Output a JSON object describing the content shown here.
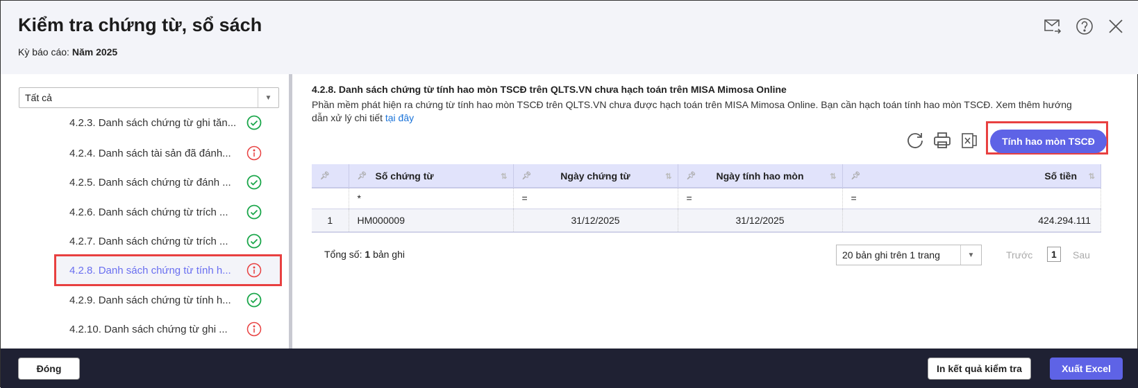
{
  "header": {
    "title": "Kiểm tra chứng từ, sổ sách",
    "period_label": "Kỳ báo cáo:",
    "period_value": "Năm 2025"
  },
  "sidebar": {
    "filter": "Tất cả",
    "items": [
      {
        "label": "4.2.3. Danh sách chứng từ ghi tăn...",
        "status": "ok"
      },
      {
        "label": "4.2.4. Danh sách tài sản đã đánh...",
        "status": "warning"
      },
      {
        "label": "4.2.5. Danh sách chứng từ đánh ...",
        "status": "ok"
      },
      {
        "label": "4.2.6. Danh sách chứng từ trích ...",
        "status": "ok"
      },
      {
        "label": "4.2.7. Danh sách chứng từ trích ...",
        "status": "ok"
      },
      {
        "label": "4.2.8. Danh sách chứng từ tính h...",
        "status": "warning",
        "active": true
      },
      {
        "label": "4.2.9. Danh sách chứng từ tính h...",
        "status": "ok"
      },
      {
        "label": "4.2.10. Danh sách chứng từ ghi ...",
        "status": "warning"
      }
    ]
  },
  "main": {
    "title": "4.2.8. Danh sách chứng từ tính hao mòn TSCĐ trên QLTS.VN chưa hạch toán trên MISA Mimosa Online",
    "description": "Phần mềm phát hiện ra chứng từ tính hao mòn TSCĐ trên QLTS.VN chưa được hạch toán trên MISA Mimosa Online. Bạn cần hạch toán tính hao mòn TSCĐ. Xem thêm hướng dẫn xử lý chi tiết",
    "link": "tại đây",
    "action_button": "Tính hao mòn TSCĐ",
    "table": {
      "columns": [
        "",
        "Số chứng từ",
        "Ngày chứng từ",
        "Ngày tính hao mòn",
        "Số tiền"
      ],
      "filters": [
        "",
        "*",
        "=",
        "=",
        "="
      ],
      "rows": [
        [
          "1",
          "HM000009",
          "31/12/2025",
          "31/12/2025",
          "424.294.111"
        ]
      ]
    },
    "total_label": "Tổng số:",
    "total_count": "1",
    "total_suffix": "bản ghi",
    "page_size": "20 bản ghi trên 1 trang",
    "prev": "Trước",
    "page": "1",
    "next": "Sau"
  },
  "footer": {
    "close": "Đóng",
    "print": "In kết quả kiểm tra",
    "export": "Xuất Excel"
  },
  "colors": {
    "accent": "#5e63e6",
    "ok": "#1aa64a",
    "warning": "#e84040",
    "footer_bg": "#1f2133"
  }
}
